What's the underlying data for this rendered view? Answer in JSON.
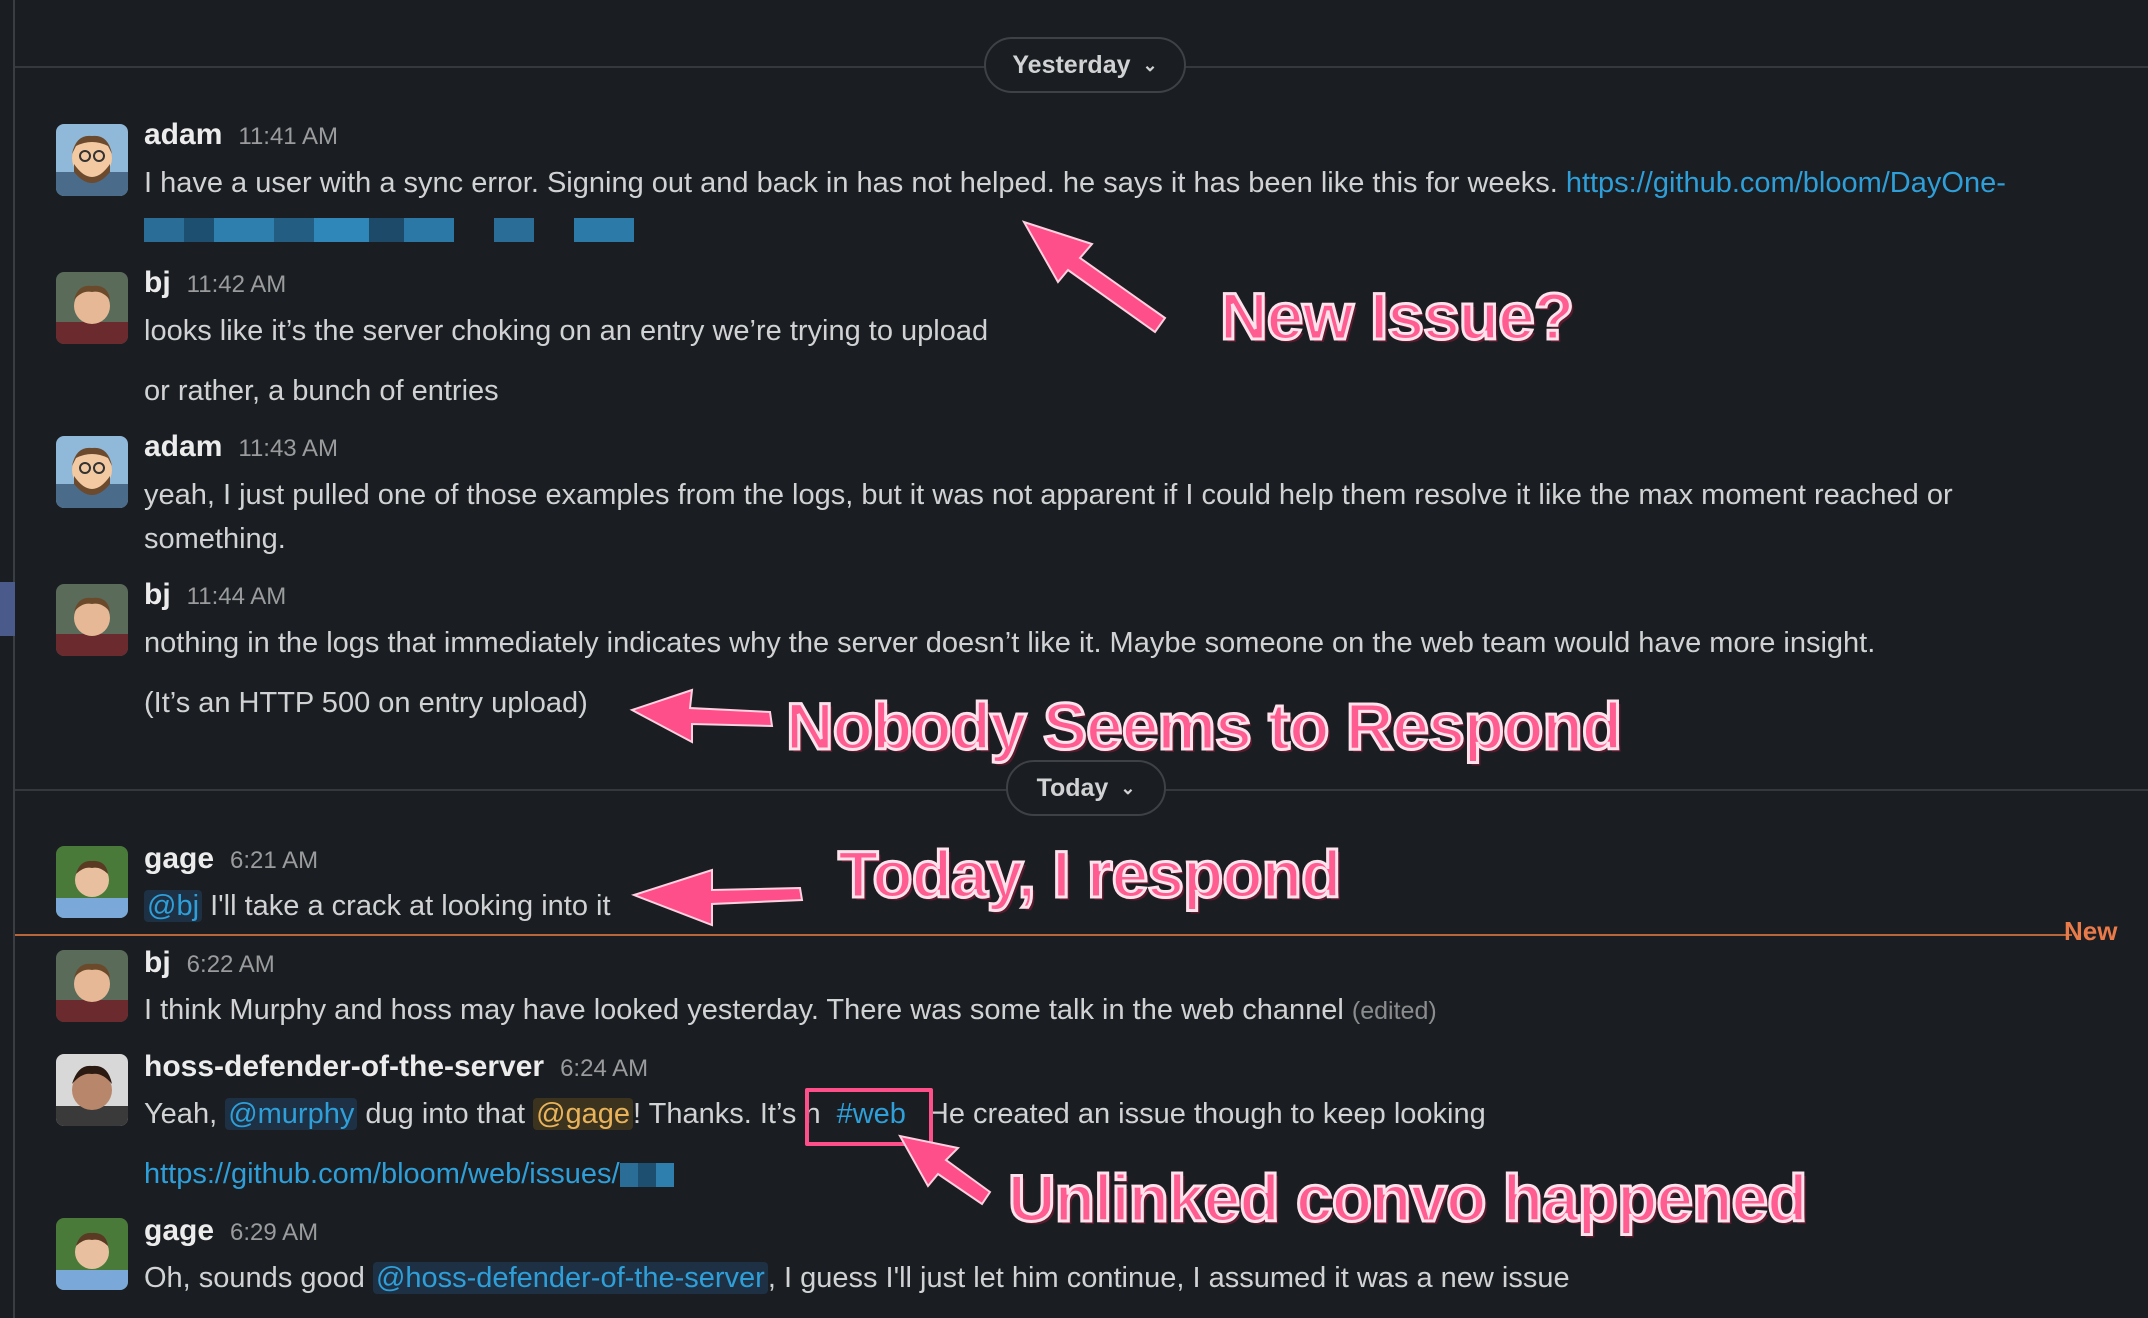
{
  "date_dividers": {
    "yesterday": {
      "label": "Yesterday",
      "icon": "chevron-down-icon"
    },
    "today": {
      "label": "Today",
      "icon": "chevron-down-icon"
    }
  },
  "new_marker": {
    "label": "New"
  },
  "messages": [
    {
      "name": "adam",
      "time": "11:41 AM",
      "text": "I have a user with a sync error. Signing out and back in has not helped. he says it has been like this for weeks. ",
      "link": "https://github.com/bloom/DayOne-"
    },
    {
      "name": "bj",
      "time": "11:42 AM",
      "text": "looks like it’s the server choking on an entry we’re trying to upload",
      "text2": "or rather, a bunch of entries"
    },
    {
      "name": "adam",
      "time": "11:43 AM",
      "text": "yeah, I just pulled one of those examples from the logs, but it was not apparent if I could help them resolve it like the max moment reached or",
      "text_cont": "something."
    },
    {
      "name": "bj",
      "time": "11:44 AM",
      "text": "nothing in the logs that immediately indicates why the server doesn’t like it. Maybe someone on the web team would have more insight.",
      "text2": "(It’s an HTTP 500 on entry upload)"
    },
    {
      "name": "gage",
      "time": "6:21 AM",
      "mention": "@bj",
      "text": " I'll take a crack at looking into it"
    },
    {
      "name": "bj",
      "time": "6:22 AM",
      "text": "I think Murphy and hoss may have looked yesterday. There was some talk in the web channel ",
      "edited": "(edited)"
    },
    {
      "name": "hoss-defender-of-the-server",
      "time": "6:24 AM",
      "pre": "Yeah, ",
      "mention1": "@murphy",
      "mid1": " dug into that ",
      "mention2": "@gage",
      "mid2": "! Thanks. It’s ",
      "frag1": "n",
      "channel": "#web",
      "frag2": "He created an issue though to keep looking",
      "link": "https://github.com/bloom/web/issues/"
    },
    {
      "name": "gage",
      "time": "6:29 AM",
      "pre": "Oh, sounds good ",
      "mention": "@hoss-defender-of-the-server",
      "text": ", I guess I'll just let him continue, I assumed it was a new issue"
    }
  ],
  "annotations": {
    "new_issue": "New Issue?",
    "nobody": "Nobody Seems to Respond",
    "today_respond": "Today, I respond",
    "unlinked": "Unlinked convo happened"
  },
  "colors": {
    "background": "#1a1d21",
    "link": "#2e9fd8",
    "new_marker": "#e97a4a",
    "annotation": "#ff5d92"
  }
}
